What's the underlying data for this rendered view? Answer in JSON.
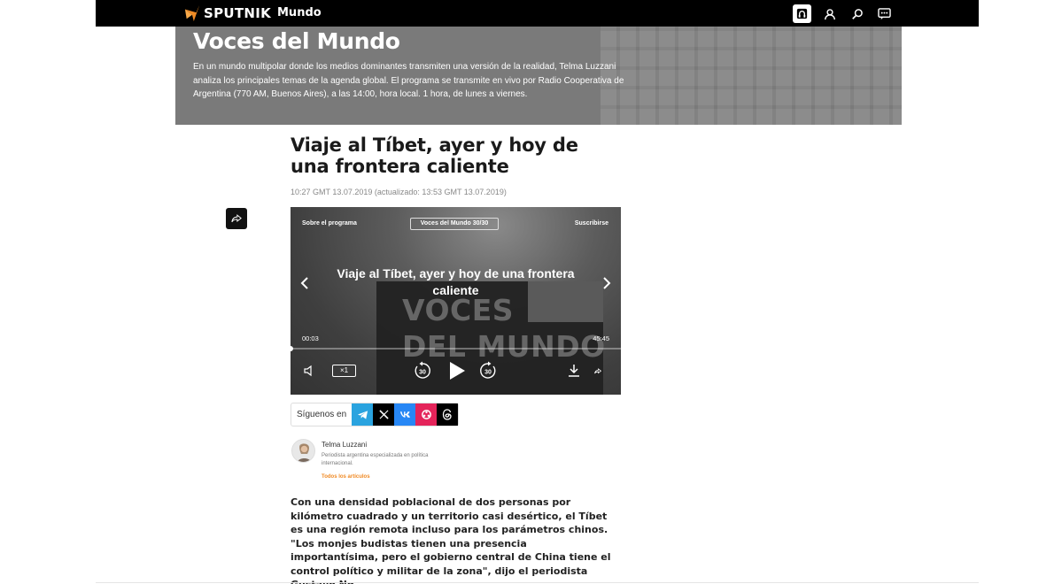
{
  "header": {
    "brand": "SPUTNIK",
    "section": "Mundo",
    "icons": [
      "radio-icon",
      "user-icon",
      "search-icon",
      "chat-icon"
    ]
  },
  "banner": {
    "title": "Voces del Mundo",
    "description": "En un mundo multipolar donde los medios dominantes transmiten una versión de la realidad, Telma Luzzani analiza los principales temas de la agenda global. El programa se transmite en vivo por Radio Cooperativa de Argentina (770 AM, Buenos Aires), a las 14:00, hora local. 1 hora, de lunes a viernes."
  },
  "article": {
    "headline": "Viaje al Tíbet, ayer y hoy de una frontera caliente",
    "dateline": "10:27 GMT 13.07.2019 (actualizado: 13:53 GMT 13.07.2019)",
    "body": "Con una densidad poblacional de dos personas por kilómetro cuadrado y un territorio casi desértico, el Tíbet es una región remota incluso para los parámetros chinos. \"Los monjes budistas tienen una presencia importantísima, pero el gobierno central de China tiene el control político y militar de la zona\", dijo el periodista Gustavo Ng."
  },
  "player": {
    "about_label": "Sobre el programa",
    "episode_label": "Voces del Mundo 30/30",
    "subscribe_label": "Suscribirse",
    "title": "Viaje al Tíbet, ayer y hoy de una frontera caliente",
    "brand_line1": "VOCES",
    "brand_line2": "DEL MUNDO",
    "current_time": "00:03",
    "total_time": "45:45",
    "progress": 0.001,
    "speed_label": "×1",
    "skip_back": "30",
    "skip_forward": "30"
  },
  "follow": {
    "label": "Síguenos en",
    "networks": [
      "telegram-icon",
      "x-icon",
      "vk-icon",
      "ok-icon",
      "threads-icon"
    ],
    "colors": {
      "telegram": "#2aa3df",
      "x": "#000000",
      "vk": "#2787f5",
      "ok": "#e4245a",
      "threads": "#000000"
    }
  },
  "author": {
    "name": "Telma Luzzani",
    "role": "Periodista argentina especializada en política internacional.",
    "all_articles": "Todos los artículos"
  },
  "colors": {
    "accent": "#f08a24",
    "topbar": "#000000"
  }
}
